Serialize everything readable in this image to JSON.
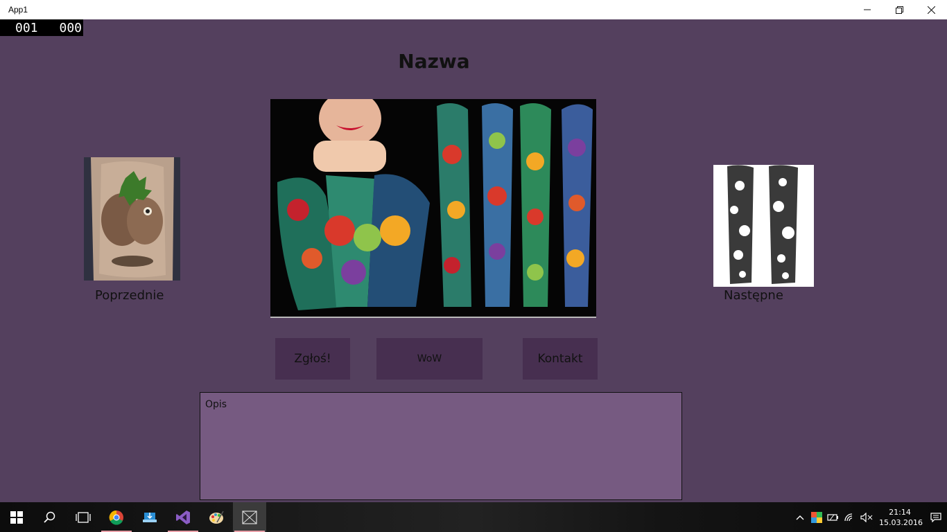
{
  "window": {
    "title": "App1",
    "minimize_label": "—",
    "restore_label": "❐",
    "close_label": "✕"
  },
  "app": {
    "counter_left": "001",
    "counter_right": "000",
    "title": "Nazwa",
    "main_image_alt": "tattoo sleeves",
    "prev_label": "Poprzednie",
    "next_label": "Następne",
    "buttons": {
      "report": "Zgłoś!",
      "wow": "WoW",
      "contact": "Kontakt"
    },
    "description": "Opis"
  },
  "taskbar": {
    "apps": [
      {
        "name": "start",
        "icon": "windows-icon"
      },
      {
        "name": "search",
        "icon": "search-icon"
      },
      {
        "name": "task-view",
        "icon": "task-view-icon"
      },
      {
        "name": "chrome",
        "icon": "chrome-icon",
        "running": true
      },
      {
        "name": "app-installer",
        "icon": "installer-icon"
      },
      {
        "name": "visual-studio",
        "icon": "visual-studio-icon",
        "running": true
      },
      {
        "name": "paint",
        "icon": "paint-icon"
      },
      {
        "name": "app1",
        "icon": "app-placeholder-icon",
        "running": true,
        "active": true
      }
    ],
    "clock_time": "21:14",
    "clock_date": "15.03.2016"
  },
  "colors": {
    "app_background": "#54405e",
    "button_background": "#472f50",
    "description_background": "#765a81",
    "counter_background": "#000000"
  }
}
